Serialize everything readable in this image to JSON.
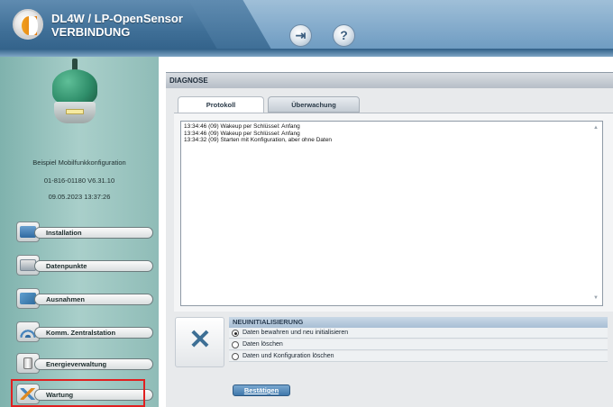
{
  "header": {
    "title_line1": "DL4W / LP-OpenSensor",
    "title_line2": "VERBINDUNG",
    "exit_icon": "exit-door-icon",
    "help_icon": "help-question-icon"
  },
  "sidebar": {
    "config_name": "Beispiel Mobilfunkkonfiguration",
    "device_id": "01-816-01180   V6.31.10",
    "datetime": "09.05.2023 13:37:26",
    "items": [
      {
        "label": "Installation",
        "icon": "installation-icon"
      },
      {
        "label": "Datenpunkte",
        "icon": "datapoints-icon"
      },
      {
        "label": "Ausnahmen",
        "icon": "exceptions-icon"
      },
      {
        "label": "Komm. Zentralstation",
        "icon": "wifi-signal-icon"
      },
      {
        "label": "Energieverwaltung",
        "icon": "battery-icon"
      },
      {
        "label": "Wartung",
        "icon": "wrench-screwdriver-icon"
      }
    ]
  },
  "main": {
    "section_title": "DIAGNOSE",
    "tabs": [
      {
        "label": "Protokoll",
        "active": true
      },
      {
        "label": "Überwachung",
        "active": false
      }
    ],
    "log_lines": [
      "13:34:46 (09)  Wakeup per Schlüssel: Anfang",
      "13:34:46 (09)  Wakeup per Schlüssel: Anfang",
      "13:34:32 (09)  Starten mit Konfiguration, aber ohne Daten"
    ]
  },
  "reinit": {
    "title": "NEUINITIALISIERUNG",
    "options": [
      {
        "label": "Daten bewahren und neu initialisieren",
        "selected": true
      },
      {
        "label": "Daten löschen",
        "selected": false
      },
      {
        "label": "Daten und Konfiguration löschen",
        "selected": false
      }
    ],
    "confirm_label": "Bestätigen"
  }
}
